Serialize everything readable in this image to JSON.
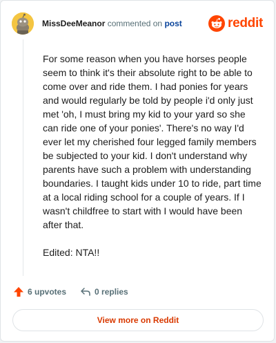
{
  "header": {
    "username": "MissDeeMeanor",
    "action_text": "commented on",
    "post_link": "post",
    "logo_text": "reddit"
  },
  "comment": {
    "paragraphs": [
      "For some reason when you have horses people seem to think it's their absolute right to be able to come over and ride them. I had ponies for years and would regularly be told by people i'd only just met 'oh, I must bring my kid to your yard so she can ride one of your ponies'. There's no way I'd ever let my cherished four legged family members be subjected to your kid. I don't understand why parents have such a problem with understanding boundaries. I taught kids under 10 to ride, part time at a local riding school for a couple of years. If I wasn't childfree to start with I would have been after that.",
      "Edited: NTA!!"
    ]
  },
  "actions": {
    "upvotes": "6 upvotes",
    "replies": "0 replies"
  },
  "footer": {
    "view_more": "View more on Reddit"
  },
  "icons": {
    "avatar": "snoo-avatar-icon",
    "logo": "reddit-logo-icon",
    "upvote": "upvote-arrow-icon",
    "reply": "reply-arrow-icon"
  },
  "colors": {
    "brand": "#ff4500",
    "upvote": "#ff4500",
    "link": "#0a449b",
    "view_more": "#d93900",
    "muted": "#576f76"
  }
}
